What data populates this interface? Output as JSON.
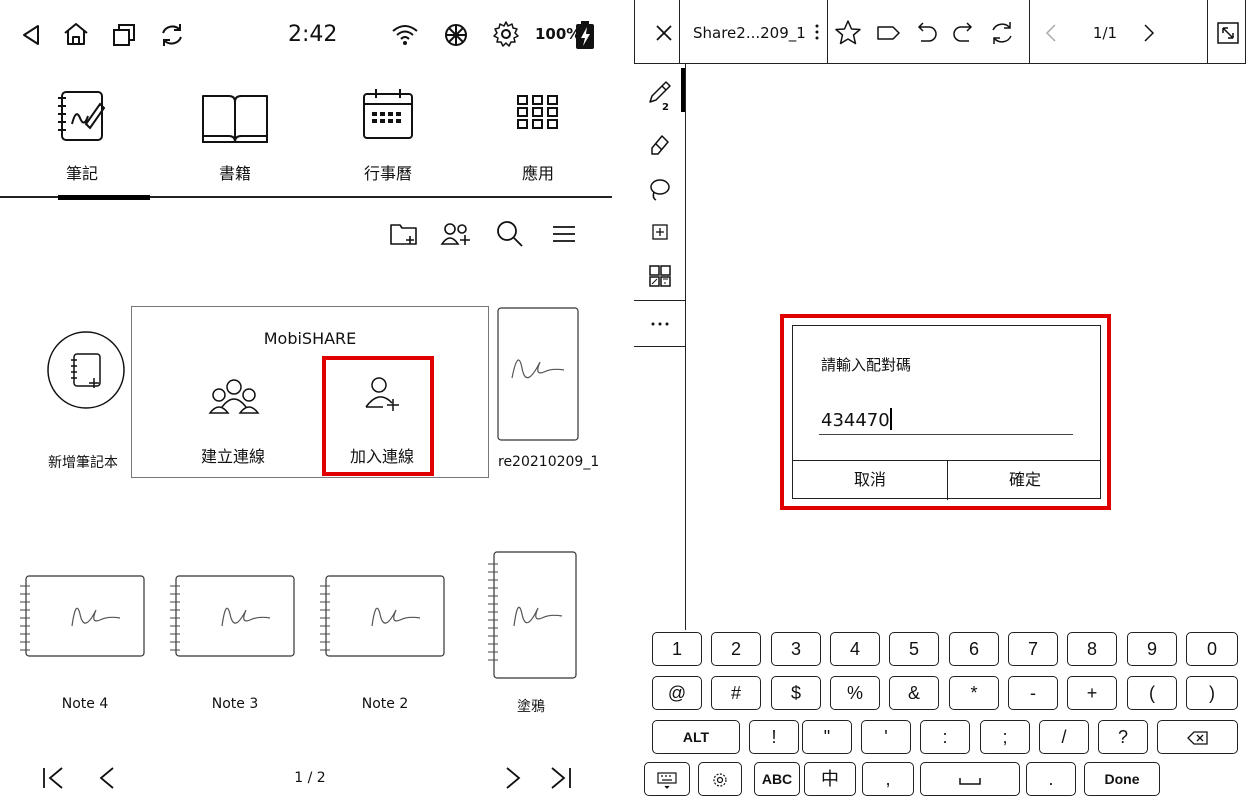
{
  "left": {
    "status": {
      "time": "2:42",
      "battery": "100%"
    },
    "tabs": [
      {
        "label": "筆記",
        "icon": "notebook-icon",
        "active": true
      },
      {
        "label": "書籍",
        "icon": "book-icon",
        "active": false
      },
      {
        "label": "行事曆",
        "icon": "calendar-icon",
        "active": false
      },
      {
        "label": "應用",
        "icon": "apps-grid-icon",
        "active": false
      }
    ],
    "toolbar_icons": [
      "new-folder-icon",
      "share-users-icon",
      "search-icon",
      "menu-icon"
    ],
    "new_notebook_label": "新增筆記本",
    "popup": {
      "title": "MobiSHARE",
      "create_label": "建立連線",
      "join_label": "加入連線"
    },
    "top_right_note_label": "re20210209_1",
    "notes": [
      "Note 4",
      "Note 3",
      "Note 2",
      "塗鴉"
    ],
    "pager": {
      "text": "1 / 2"
    }
  },
  "right": {
    "topbar": {
      "doc_title": "Share2...209_1",
      "page_text": "1/1"
    },
    "sidebar_badge": "2",
    "dialog": {
      "prompt": "請輸入配對碼",
      "value": "434470",
      "cancel_label": "取消",
      "confirm_label": "確定"
    },
    "keyboard": {
      "row1": [
        "1",
        "2",
        "3",
        "4",
        "5",
        "6",
        "7",
        "8",
        "9",
        "0"
      ],
      "row2": [
        "@",
        "#",
        "$",
        "%",
        "&",
        "*",
        "-",
        "+",
        "(",
        ")"
      ],
      "row3": [
        "ALT",
        "!",
        "\"",
        "'",
        ":",
        ";",
        "/",
        "?"
      ],
      "row4": [
        "ABC",
        "中",
        ",",
        ".",
        "Done"
      ]
    }
  }
}
